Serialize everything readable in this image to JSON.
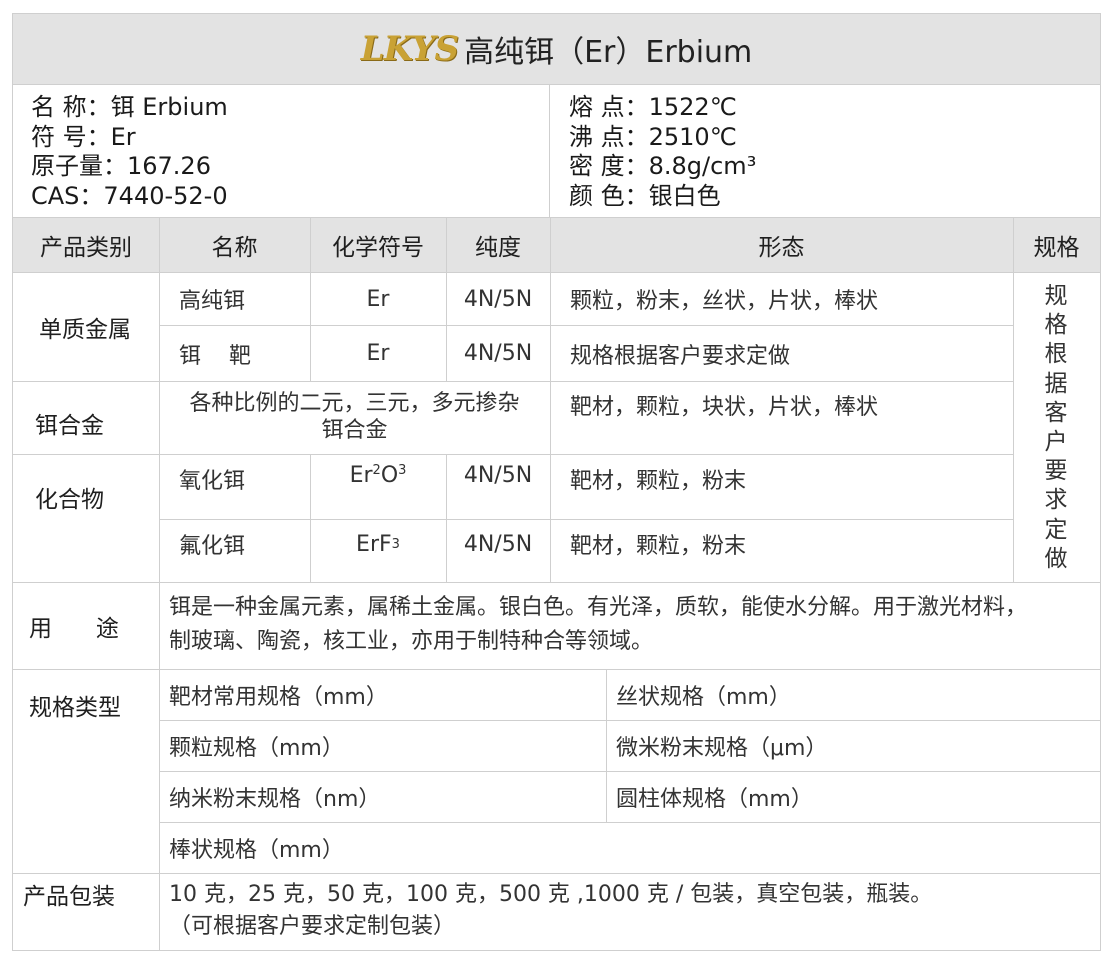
{
  "title": {
    "logo": "LKYS",
    "text": "高纯铒（Er）Erbium"
  },
  "info": {
    "left": [
      "名  称：铒 Erbium",
      "符  号：Er",
      "原子量：167.26",
      "CAS：7440-52-0"
    ],
    "right": [
      "熔  点：1522℃",
      "沸  点：2510℃",
      "密  度：8.8g/cm³",
      "颜  色：银白色"
    ]
  },
  "table": {
    "headers": [
      "产品类别",
      "名称",
      "化学符号",
      "纯度",
      "形态",
      "规格"
    ],
    "groups": {
      "metal": "单质金属",
      "alloy": "铒合金",
      "compound": "化合物"
    },
    "rows": [
      {
        "name": "高纯铒",
        "symbol": "Er",
        "purity": "4N/5N",
        "form": "颗粒，粉末，丝状，片状，棒状"
      },
      {
        "name": "铒    靶",
        "symbol": "Er",
        "purity": "4N/5N",
        "form": "规格根据客户要求定做"
      },
      {
        "name": "各种比例的二元，三元，多元掺杂",
        "name2": "铒合金",
        "form": "靶材，颗粒，块状，片状，棒状"
      },
      {
        "name": "氧化铒",
        "symbol_base": "Er",
        "symbol_sub1": "2",
        "symbol_mid": "O",
        "symbol_sub2": "3",
        "purity": "4N/5N",
        "form": "靶材，颗粒，粉末"
      },
      {
        "name": "氟化铒",
        "symbol_base": "ErF",
        "symbol_sub1": "3",
        "purity": "4N/5N",
        "form": "靶材，颗粒，粉末"
      }
    ],
    "spec_vertical": [
      "规",
      "格",
      "根",
      "据",
      "客",
      "户",
      "要",
      "求",
      "定",
      "做"
    ]
  },
  "usage": {
    "label": "用      途",
    "line1": "铒是一种金属元素，属稀土金属。银白色。有光泽，质软，能使水分解。用于激光材料，",
    "line2": "制玻璃、陶瓷，核工业，亦用于制特种合等领域。"
  },
  "spec_types": {
    "label": "规格类型",
    "items": [
      "靶材常用规格（mm）",
      "丝状规格（mm）",
      "颗粒规格（mm）",
      "微米粉末规格（μm）",
      "纳米粉末规格（nm）",
      "圆柱体规格（mm）",
      "棒状规格（mm）"
    ]
  },
  "packaging": {
    "label": "产品包装",
    "line1": "10 克，25 克，50 克，100 克，500 克 ,1000 克 / 包装，真空包装，瓶装。",
    "line2": "（可根据客户要求定制包装）"
  }
}
